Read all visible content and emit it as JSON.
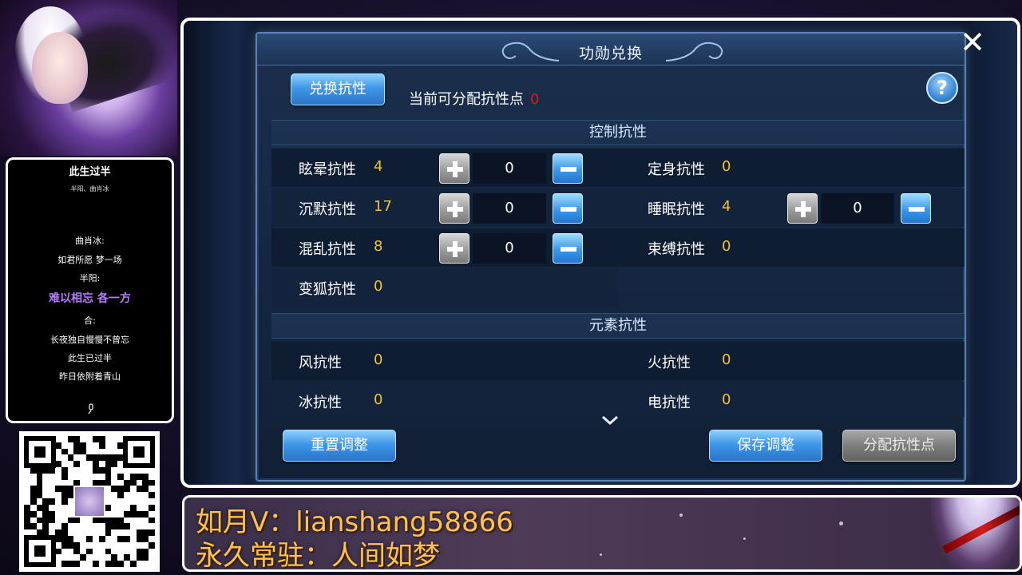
{
  "overlay": {
    "song_title": "此生过半",
    "song_artists": "半阳、曲肖冰",
    "lyrics": [
      "曲肖冰:",
      "如君所愿 梦一场",
      "半阳:",
      "难以相忘 各一方",
      "合:",
      "长夜独自慢慢不曾忘",
      "此生已过半",
      "昨日依附着青山"
    ],
    "highlight_color": "#b57cff",
    "banner_line1": "如月V：lianshang58866",
    "banner_line2": "永久常驻：人间如梦"
  },
  "dialog": {
    "title": "功勋兑换",
    "exchange_button": "兑换抗性",
    "points_label": "当前可分配抗性点",
    "points_value": "0",
    "help_label": "?",
    "close_label": "✕",
    "sections": {
      "control": "控制抗性",
      "element": "元素抗性"
    },
    "control_resists": [
      {
        "label": "眩晕抗性",
        "value": "4",
        "input": "0"
      },
      {
        "label": "定身抗性",
        "value": "0"
      },
      {
        "label": "沉默抗性",
        "value": "17",
        "input": "0"
      },
      {
        "label": "睡眠抗性",
        "value": "4",
        "input": "0"
      },
      {
        "label": "混乱抗性",
        "value": "8",
        "input": "0"
      },
      {
        "label": "束缚抗性",
        "value": "0"
      },
      {
        "label": "变狐抗性",
        "value": "0"
      }
    ],
    "element_resists": [
      {
        "label": "风抗性",
        "value": "0"
      },
      {
        "label": "火抗性",
        "value": "0"
      },
      {
        "label": "冰抗性",
        "value": "0"
      },
      {
        "label": "电抗性",
        "value": "0"
      }
    ],
    "reset_button": "重置调整",
    "save_button": "保存调整",
    "allocate_button": "分配抗性点",
    "colors": {
      "value_gold": "#f2c230",
      "points_red": "#e01818",
      "button_blue": "#3f97e8",
      "button_gray": "#7d7d7d"
    }
  }
}
